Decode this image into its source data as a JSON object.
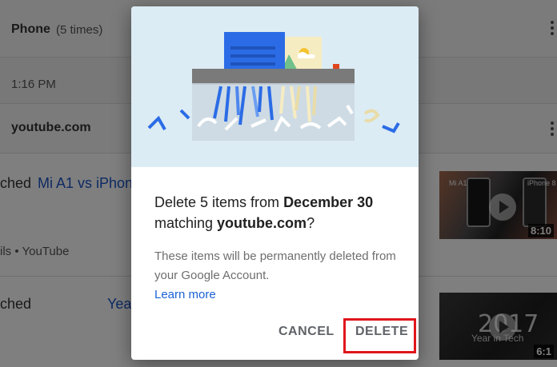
{
  "background": {
    "phone_row": {
      "label": "Phone",
      "count": "(5 times)"
    },
    "time_row": {
      "time": "1:16 PM"
    },
    "site_row": {
      "label": "youtube.com"
    },
    "item1": {
      "prefix": "ched",
      "link": "Mi A1 vs iPhone",
      "source": "ils • YouTube",
      "thumb_label_left": "Mi A1",
      "thumb_label_right": "iPhone 8",
      "duration": "8:10"
    },
    "item2": {
      "prefix": "ched",
      "link": "Yea",
      "thumb_year": "2017",
      "thumb_subtitle": "Year in Tech",
      "duration": "6:1"
    }
  },
  "dialog": {
    "title_part1": "Delete 5 items from ",
    "title_date": "December 30",
    "title_part2": "matching ",
    "title_site": "youtube.com",
    "title_end": "?",
    "description": "These items will be permanently deleted from your Google Account.",
    "learn_more": "Learn more",
    "cancel_label": "CANCEL",
    "delete_label": "DELETE"
  },
  "colors": {
    "illustration_bg": "#dcecf4",
    "link_blue": "#1a62d6",
    "highlight_red": "#e0161c",
    "shredder_gray": "#7a7a7a",
    "doc_blue": "#2b6ce6",
    "paper_yellow": "#f6ecc2"
  },
  "icons": {
    "more": "more-vert-icon",
    "play": "play-icon",
    "illustration": "shredder-illustration"
  }
}
